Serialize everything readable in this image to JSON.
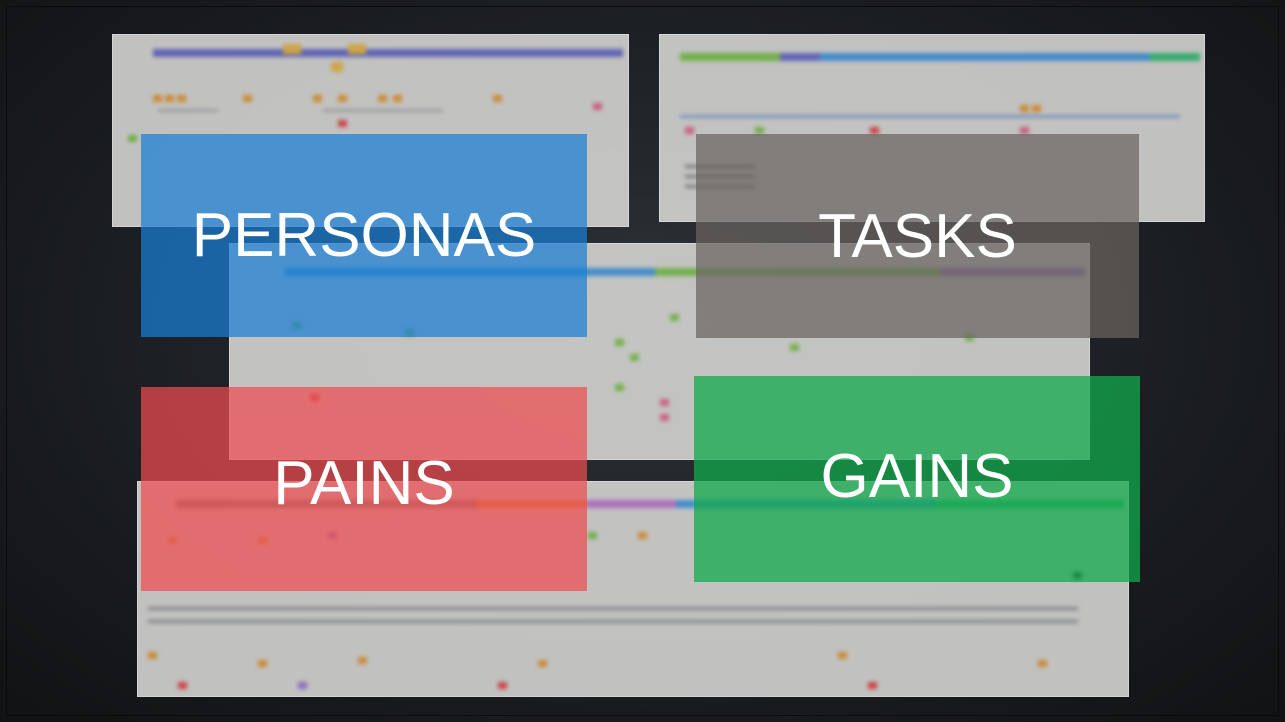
{
  "labels": {
    "personas": "PERSONAS",
    "tasks": "TASKS",
    "pains": "PAINS",
    "gains": "GAINS"
  },
  "colors": {
    "personas": "#1f7fd4",
    "tasks": "#6e6a66",
    "pains": "#e5484d",
    "gains": "#16a84c",
    "background": "#1a1d21"
  }
}
